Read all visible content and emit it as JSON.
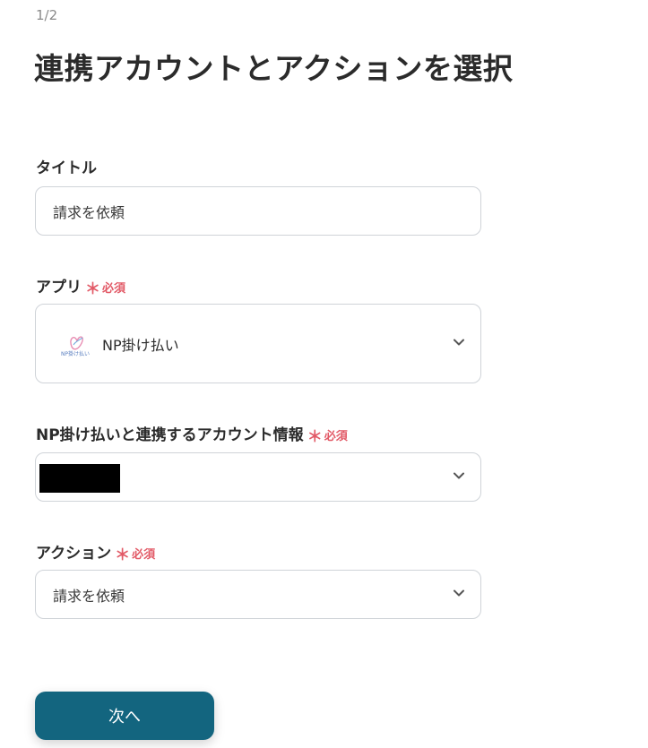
{
  "step_indicator": "1/2",
  "page_title": "連携アカウントとアクションを選択",
  "required_label": "必須",
  "title_field": {
    "label": "タイトル",
    "value": "請求を依頼"
  },
  "app_field": {
    "label": "アプリ",
    "selected_app": "NP掛け払い",
    "logo_text": "NP掛け払い",
    "icon": "chevron-down-icon"
  },
  "account_field": {
    "label": "NP掛け払いと連携するアカウント情報",
    "icon": "chevron-down-icon"
  },
  "action_field": {
    "label": "アクション",
    "value": "請求を依頼",
    "icon": "chevron-down-icon"
  },
  "next_button": {
    "label": "次へ"
  },
  "colors": {
    "primary_button": "#13657f",
    "required": "#e25a67",
    "border": "#cfd3d8"
  }
}
